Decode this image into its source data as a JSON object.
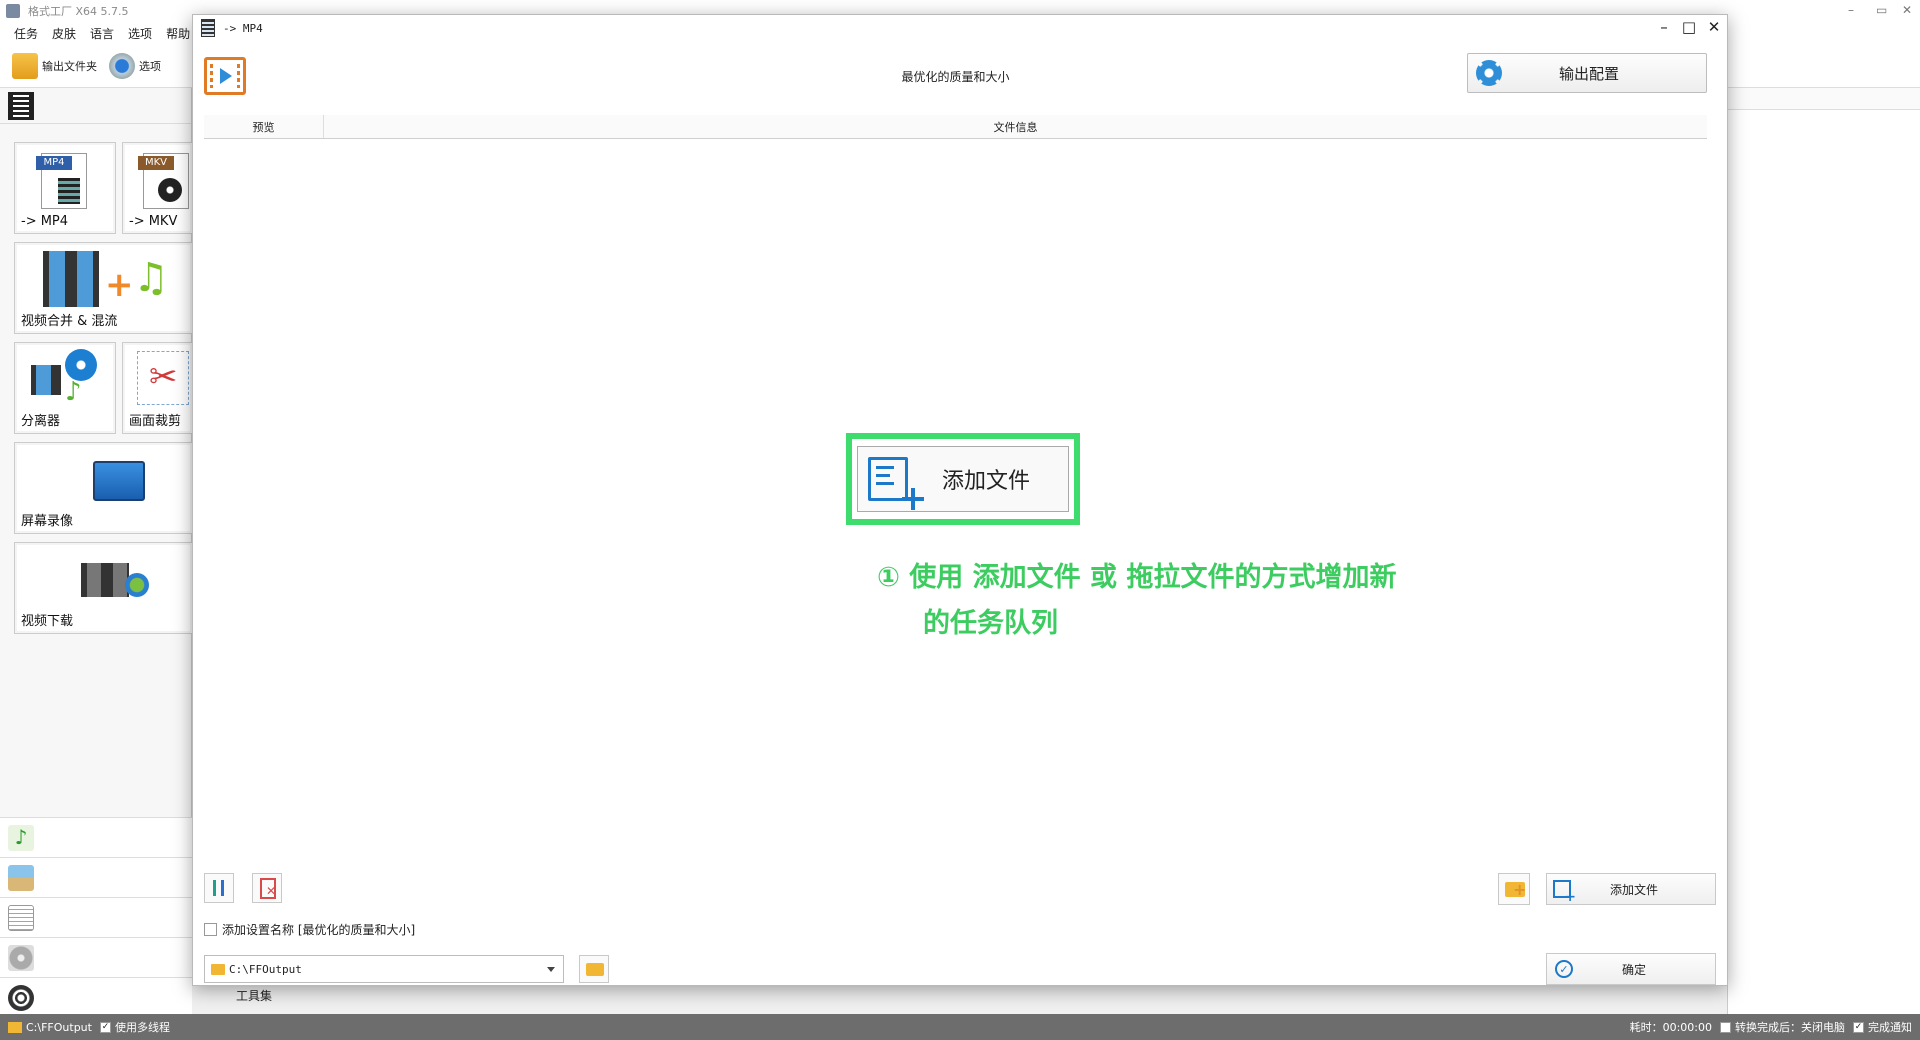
{
  "app": {
    "title": "格式工厂 X64 5.7.5",
    "window_controls": [
      "–",
      "▭",
      "✕"
    ]
  },
  "menu": [
    "任务",
    "皮肤",
    "语言",
    "选项",
    "帮助"
  ],
  "toolbar": {
    "output_folder_label": "输出文件夹",
    "options_label": "选项"
  },
  "sidebar": {
    "tiles": [
      {
        "label": "-> MP4",
        "badge": "MP4"
      },
      {
        "label": "-> MKV",
        "badge": "MKV"
      },
      {
        "label": "视频合并 & 混流"
      },
      {
        "label": "分离器"
      },
      {
        "label": "画面裁剪"
      },
      {
        "label": "屏幕录像"
      },
      {
        "label": "视频下载"
      }
    ],
    "toolset_label": "工具集"
  },
  "dialog": {
    "title": "-> MP4",
    "subtitle": "最优化的质量和大小",
    "output_config_label": "输出配置",
    "table_headers": {
      "preview": "预览",
      "file_info": "文件信息"
    },
    "add_file_big_label": "添加文件",
    "hint_line1": "① 使用 添加文件 或 拖拉文件的方式增加新",
    "hint_line2": "的任务队列",
    "add_file_small_label": "添加文件",
    "add_setting_name_label": "添加设置名称 [最优化的质量和大小]",
    "output_path": "C:\\FFOutput",
    "ok_label": "确定"
  },
  "statusbar": {
    "path": "C:\\FFOutput",
    "multithread_label": "使用多线程",
    "elapsed": "耗时：00:00:00",
    "after_convert_label": "转换完成后：关闭电脑",
    "notify_label": "完成通知"
  },
  "colors": {
    "highlight_green": "#3ddc6d",
    "hint_green": "#3ccc60",
    "accent_blue": "#1c78c8",
    "video_orange": "#e07a24"
  }
}
